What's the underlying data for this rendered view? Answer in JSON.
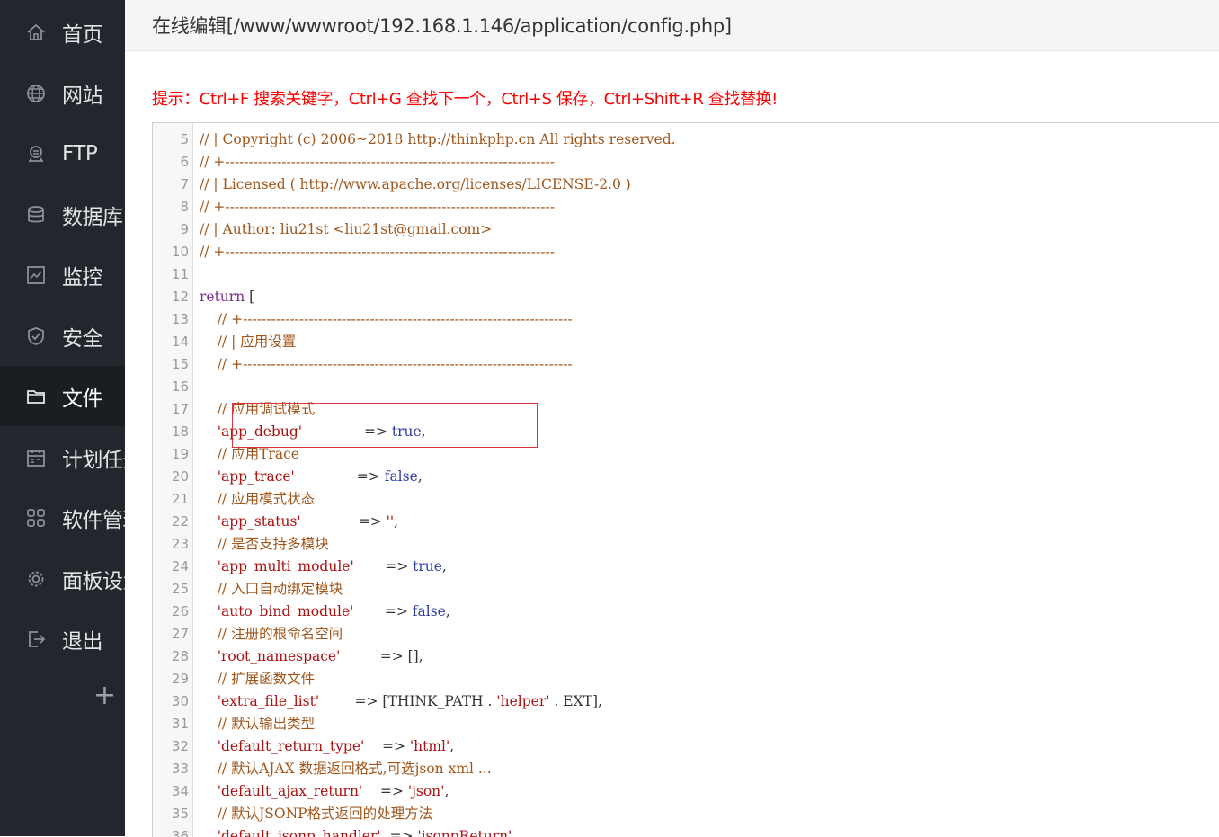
{
  "sidebar": {
    "items": [
      {
        "label": "首页",
        "icon": "home-icon",
        "active": false
      },
      {
        "label": "网站",
        "icon": "globe-icon",
        "active": false
      },
      {
        "label": "FTP",
        "icon": "ftp-icon",
        "active": false
      },
      {
        "label": "数据库",
        "icon": "database-icon",
        "active": false
      },
      {
        "label": "监控",
        "icon": "monitor-icon",
        "active": false
      },
      {
        "label": "安全",
        "icon": "shield-icon",
        "active": false
      },
      {
        "label": "文件",
        "icon": "folder-icon",
        "active": true
      },
      {
        "label": "计划任务",
        "icon": "calendar-icon",
        "active": false
      },
      {
        "label": "软件管理",
        "icon": "apps-icon",
        "active": false
      },
      {
        "label": "面板设置",
        "icon": "gear-icon",
        "active": false
      },
      {
        "label": "退出",
        "icon": "logout-icon",
        "active": false
      }
    ],
    "add_label": "+"
  },
  "header": {
    "title": "在线编辑[/www/wwwroot/192.168.1.146/application/config.php]"
  },
  "hint": "提示：Ctrl+F 搜索关键字，Ctrl+G 查找下一个，Ctrl+S 保存，Ctrl+Shift+R 查找替换!",
  "editor": {
    "lines": [
      {
        "num": "5",
        "tokens": [
          {
            "t": "// | Copyright (c) 2006~2018 http://thinkphp.cn All rights reserved.",
            "c": "comment"
          }
        ]
      },
      {
        "num": "6",
        "tokens": [
          {
            "t": "// +----------------------------------------------------------------------",
            "c": "comment"
          }
        ]
      },
      {
        "num": "7",
        "tokens": [
          {
            "t": "// | Licensed ( http://www.apache.org/licenses/LICENSE-2.0 )",
            "c": "comment"
          }
        ]
      },
      {
        "num": "8",
        "tokens": [
          {
            "t": "// +----------------------------------------------------------------------",
            "c": "comment"
          }
        ]
      },
      {
        "num": "9",
        "tokens": [
          {
            "t": "// | Author: liu21st <liu21st@gmail.com>",
            "c": "comment"
          }
        ]
      },
      {
        "num": "10",
        "tokens": [
          {
            "t": "// +----------------------------------------------------------------------",
            "c": "comment"
          }
        ]
      },
      {
        "num": "11",
        "tokens": []
      },
      {
        "num": "12",
        "tokens": [
          {
            "t": "return",
            "c": "keyword"
          },
          {
            "t": " [",
            "c": "default"
          }
        ]
      },
      {
        "num": "13",
        "tokens": [
          {
            "t": "    // +----------------------------------------------------------------------",
            "c": "comment"
          }
        ]
      },
      {
        "num": "14",
        "tokens": [
          {
            "t": "    // | 应用设置",
            "c": "comment"
          }
        ]
      },
      {
        "num": "15",
        "tokens": [
          {
            "t": "    // +----------------------------------------------------------------------",
            "c": "comment"
          }
        ]
      },
      {
        "num": "16",
        "tokens": []
      },
      {
        "num": "17",
        "tokens": [
          {
            "t": "    // 应用调试模式",
            "c": "comment"
          }
        ]
      },
      {
        "num": "18",
        "tokens": [
          {
            "t": "    ",
            "c": "default"
          },
          {
            "t": "'app_debug'",
            "c": "string"
          },
          {
            "t": "              => ",
            "c": "default"
          },
          {
            "t": "true",
            "c": "atom"
          },
          {
            "t": ",",
            "c": "default"
          }
        ]
      },
      {
        "num": "19",
        "tokens": [
          {
            "t": "    // 应用Trace",
            "c": "comment"
          }
        ]
      },
      {
        "num": "20",
        "tokens": [
          {
            "t": "    ",
            "c": "default"
          },
          {
            "t": "'app_trace'",
            "c": "string"
          },
          {
            "t": "              => ",
            "c": "default"
          },
          {
            "t": "false",
            "c": "atom"
          },
          {
            "t": ",",
            "c": "default"
          }
        ]
      },
      {
        "num": "21",
        "tokens": [
          {
            "t": "    // 应用模式状态",
            "c": "comment"
          }
        ]
      },
      {
        "num": "22",
        "tokens": [
          {
            "t": "    ",
            "c": "default"
          },
          {
            "t": "'app_status'",
            "c": "string"
          },
          {
            "t": "             => ",
            "c": "default"
          },
          {
            "t": "''",
            "c": "string"
          },
          {
            "t": ",",
            "c": "default"
          }
        ]
      },
      {
        "num": "23",
        "tokens": [
          {
            "t": "    // 是否支持多模块",
            "c": "comment"
          }
        ]
      },
      {
        "num": "24",
        "tokens": [
          {
            "t": "    ",
            "c": "default"
          },
          {
            "t": "'app_multi_module'",
            "c": "string"
          },
          {
            "t": "       => ",
            "c": "default"
          },
          {
            "t": "true",
            "c": "atom"
          },
          {
            "t": ",",
            "c": "default"
          }
        ]
      },
      {
        "num": "25",
        "tokens": [
          {
            "t": "    // 入口自动绑定模块",
            "c": "comment"
          }
        ]
      },
      {
        "num": "26",
        "tokens": [
          {
            "t": "    ",
            "c": "default"
          },
          {
            "t": "'auto_bind_module'",
            "c": "string"
          },
          {
            "t": "       => ",
            "c": "default"
          },
          {
            "t": "false",
            "c": "atom"
          },
          {
            "t": ",",
            "c": "default"
          }
        ]
      },
      {
        "num": "27",
        "tokens": [
          {
            "t": "    // 注册的根命名空间",
            "c": "comment"
          }
        ]
      },
      {
        "num": "28",
        "tokens": [
          {
            "t": "    ",
            "c": "default"
          },
          {
            "t": "'root_namespace'",
            "c": "string"
          },
          {
            "t": "         => [],",
            "c": "default"
          }
        ]
      },
      {
        "num": "29",
        "tokens": [
          {
            "t": "    // 扩展函数文件",
            "c": "comment"
          }
        ]
      },
      {
        "num": "30",
        "tokens": [
          {
            "t": "    ",
            "c": "default"
          },
          {
            "t": "'extra_file_list'",
            "c": "string"
          },
          {
            "t": "        => [THINK_PATH . ",
            "c": "default"
          },
          {
            "t": "'helper'",
            "c": "string"
          },
          {
            "t": " . EXT],",
            "c": "default"
          }
        ]
      },
      {
        "num": "31",
        "tokens": [
          {
            "t": "    // 默认输出类型",
            "c": "comment"
          }
        ]
      },
      {
        "num": "32",
        "tokens": [
          {
            "t": "    ",
            "c": "default"
          },
          {
            "t": "'default_return_type'",
            "c": "string"
          },
          {
            "t": "    => ",
            "c": "default"
          },
          {
            "t": "'html'",
            "c": "string"
          },
          {
            "t": ",",
            "c": "default"
          }
        ]
      },
      {
        "num": "33",
        "tokens": [
          {
            "t": "    // 默认AJAX 数据返回格式,可选json xml ...",
            "c": "comment"
          }
        ]
      },
      {
        "num": "34",
        "tokens": [
          {
            "t": "    ",
            "c": "default"
          },
          {
            "t": "'default_ajax_return'",
            "c": "string"
          },
          {
            "t": "    => ",
            "c": "default"
          },
          {
            "t": "'json'",
            "c": "string"
          },
          {
            "t": ",",
            "c": "default"
          }
        ]
      },
      {
        "num": "35",
        "tokens": [
          {
            "t": "    // 默认JSONP格式返回的处理方法",
            "c": "comment"
          }
        ]
      },
      {
        "num": "36",
        "tokens": [
          {
            "t": "    ",
            "c": "default"
          },
          {
            "t": "'default_jsonp_handler'",
            "c": "string"
          },
          {
            "t": "  => ",
            "c": "default"
          },
          {
            "t": "'jsonpReturn'",
            "c": "string"
          },
          {
            "t": ",",
            "c": "default"
          }
        ]
      }
    ]
  }
}
